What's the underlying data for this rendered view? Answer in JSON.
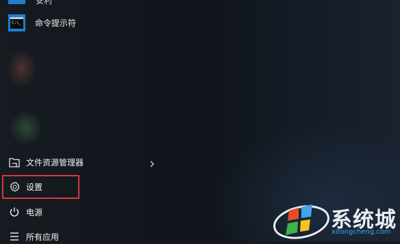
{
  "start_menu": {
    "top_partial_label": "安利",
    "apps": [
      {
        "label": "命令提示符",
        "icon": "command-prompt-icon"
      }
    ],
    "bottom_items": [
      {
        "label": "文件资源管理器",
        "icon": "file-explorer-icon",
        "has_submenu": true
      },
      {
        "label": "设置",
        "icon": "settings-gear-icon",
        "highlighted": true
      },
      {
        "label": "电源",
        "icon": "power-icon"
      },
      {
        "label": "所有应用",
        "icon": "all-apps-icon"
      }
    ]
  },
  "watermark": {
    "text": "系统城",
    "url": "xitongcheng.com",
    "logo": "windows-logo"
  },
  "colors": {
    "tile_blue": "#1c7fd2",
    "highlight_red": "#d93a3a",
    "background": "#141a20"
  },
  "cmd_glyph": "C:\\_"
}
